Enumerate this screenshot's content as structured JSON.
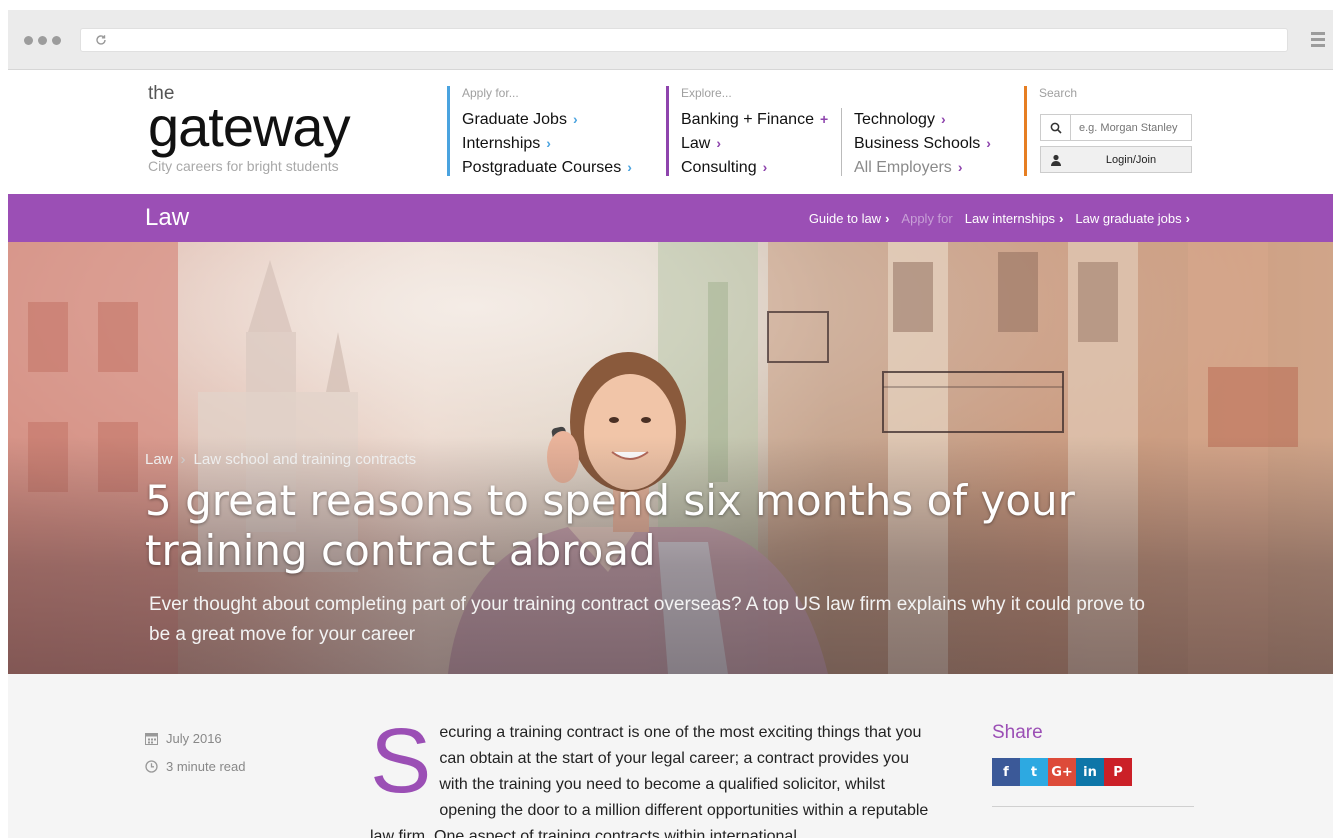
{
  "logo": {
    "the": "the",
    "name": "gateway",
    "tagline": "City careers for bright students"
  },
  "nav": {
    "apply": {
      "heading": "Apply for...",
      "links": [
        "Graduate Jobs",
        "Internships",
        "Postgraduate Courses"
      ]
    },
    "explore": {
      "heading": "Explore...",
      "links": [
        "Banking + Finance",
        "Law",
        "Consulting"
      ],
      "more_links": [
        "Technology",
        "Business Schools",
        "All Employers"
      ]
    },
    "search": {
      "heading": "Search",
      "placeholder": "e.g. Morgan Stanley",
      "login_label": "Login/Join"
    }
  },
  "section_bar": {
    "title": "Law",
    "guide_link": "Guide to law",
    "apply_label": "Apply for",
    "internships_link": "Law internships",
    "grad_jobs_link": "Law graduate jobs"
  },
  "hero": {
    "breadcrumb": [
      "Law",
      "Law school and training contracts"
    ],
    "title": "5 great reasons to spend six months of your training contract abroad",
    "subtitle": "Ever thought about completing part of your training contract overseas? A top US law firm explains why it could prove to be a great move for your career"
  },
  "meta": {
    "date": "July 2016",
    "read_time": "3 minute read"
  },
  "article": {
    "dropcap": "S",
    "text": "ecuring a training contract is one of the most exciting things that you can obtain at the start of your legal career; a contract provides you with the training you need to become a qualified solicitor, whilst opening the door to a million different opportunities within a reputable law firm. One aspect of training contracts within international"
  },
  "share": {
    "title": "Share",
    "buttons": [
      {
        "icon": "facebook-icon",
        "glyph": "f",
        "color": "#3b5998"
      },
      {
        "icon": "twitter-icon",
        "glyph": "t",
        "color": "#2da9e1"
      },
      {
        "icon": "google-plus-icon",
        "glyph": "G+",
        "color": "#dd4b39"
      },
      {
        "icon": "linkedin-icon",
        "glyph": "in",
        "color": "#0e76a8"
      },
      {
        "icon": "pinterest-icon",
        "glyph": "P",
        "color": "#cb2027"
      }
    ]
  },
  "colors": {
    "accent": "#9b4fb5",
    "apply_border": "#4aa3df",
    "search_border": "#e67e22"
  }
}
